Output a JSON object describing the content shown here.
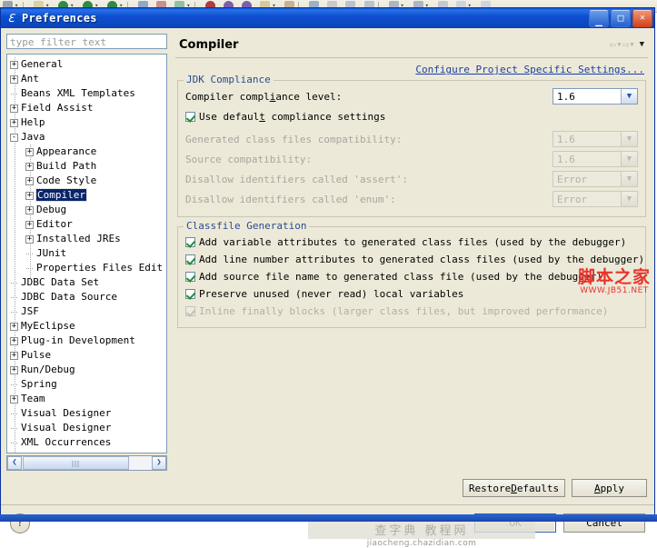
{
  "window": {
    "title": "Preferences",
    "logo_icon": "eclipse-logo-icon",
    "minimize_label": "_",
    "maximize_label": "□",
    "close_label": "✕"
  },
  "filter": {
    "placeholder": "type filter text",
    "value": ""
  },
  "tree": {
    "selected": "Compiler",
    "items": [
      {
        "label": "General",
        "level": 0,
        "expander": "+"
      },
      {
        "label": "Ant",
        "level": 0,
        "expander": "+"
      },
      {
        "label": "Beans XML Templates",
        "level": 0,
        "expander": ""
      },
      {
        "label": "Field Assist",
        "level": 0,
        "expander": "+"
      },
      {
        "label": "Help",
        "level": 0,
        "expander": "+"
      },
      {
        "label": "Java",
        "level": 0,
        "expander": "-"
      },
      {
        "label": "Appearance",
        "level": 1,
        "expander": "+"
      },
      {
        "label": "Build Path",
        "level": 1,
        "expander": "+"
      },
      {
        "label": "Code Style",
        "level": 1,
        "expander": "+"
      },
      {
        "label": "Compiler",
        "level": 1,
        "expander": "+"
      },
      {
        "label": "Debug",
        "level": 1,
        "expander": "+"
      },
      {
        "label": "Editor",
        "level": 1,
        "expander": "+"
      },
      {
        "label": "Installed JREs",
        "level": 1,
        "expander": "+"
      },
      {
        "label": "JUnit",
        "level": 1,
        "expander": ""
      },
      {
        "label": "Properties Files Edit",
        "level": 1,
        "expander": ""
      },
      {
        "label": "JDBC Data Set",
        "level": 0,
        "expander": ""
      },
      {
        "label": "JDBC Data Source",
        "level": 0,
        "expander": ""
      },
      {
        "label": "JSF",
        "level": 0,
        "expander": ""
      },
      {
        "label": "MyEclipse",
        "level": 0,
        "expander": "+"
      },
      {
        "label": "Plug-in Development",
        "level": 0,
        "expander": "+"
      },
      {
        "label": "Pulse",
        "level": 0,
        "expander": "+"
      },
      {
        "label": "Run/Debug",
        "level": 0,
        "expander": "+"
      },
      {
        "label": "Spring",
        "level": 0,
        "expander": ""
      },
      {
        "label": "Team",
        "level": 0,
        "expander": "+"
      },
      {
        "label": "Visual Designer",
        "level": 0,
        "expander": ""
      },
      {
        "label": "Visual Designer",
        "level": 0,
        "expander": ""
      },
      {
        "label": "XML Occurrences",
        "level": 0,
        "expander": ""
      }
    ],
    "scroll_left_label": "❮",
    "scroll_right_label": "❯"
  },
  "page": {
    "title": "Compiler",
    "back_icon": "back-arrow-icon",
    "forward_icon": "forward-arrow-icon",
    "menu_icon": "chevron-down-icon",
    "configure_link": "Configure Project Specific Settings..."
  },
  "jdk_compliance": {
    "group_label": "JDK Compliance",
    "compliance_level": {
      "label": "Compiler compliance level:",
      "value": "1.6",
      "enabled": true
    },
    "use_default": {
      "label": "Use default compliance settings",
      "checked": true,
      "enabled": true
    },
    "rows": [
      {
        "label": "Generated  class files compatibility:",
        "value": "1.6",
        "enabled": false
      },
      {
        "label": "Source compatibility:",
        "value": "1.6",
        "enabled": false
      },
      {
        "label": "Disallow identifiers called 'assert':",
        "value": "Error",
        "enabled": false
      },
      {
        "label": "Disallow identifiers called 'enum':",
        "value": "Error",
        "enabled": false
      }
    ]
  },
  "classfile_generation": {
    "group_label": "Classfile Generation",
    "checkboxes": [
      {
        "label": "Add variable attributes to generated class files (used by the debugger)",
        "checked": true,
        "enabled": true
      },
      {
        "label": "Add line number attributes to generated class files (used by the debugger)",
        "checked": true,
        "enabled": true
      },
      {
        "label": "Add source file name to generated class file (used by the debugger)",
        "checked": true,
        "enabled": true
      },
      {
        "label": "Preserve unused (never read) local variables",
        "checked": true,
        "enabled": true
      },
      {
        "label": "Inline finally blocks (larger class files, but improved performance)",
        "checked": true,
        "enabled": false
      }
    ]
  },
  "footer": {
    "restore_defaults": "Restore Defaults",
    "apply": "Apply",
    "ok": "OK",
    "cancel": "Cancel",
    "help_icon": "question-mark-icon",
    "help_label": "?"
  },
  "watermarks": {
    "primary_cn": "脚本之家",
    "primary_url": "WWW.JB51.NET",
    "secondary_cn": "查字典 教程网",
    "secondary_url": "jiaocheng.chazidian.com"
  },
  "colors": {
    "dialog_bg": "#ece9d8",
    "title_blue": "#0b50cf",
    "group_label": "#2b4b8f",
    "link": "#1b3fa6",
    "selection": "#0a246a",
    "watermark_red": "#e8342c"
  }
}
